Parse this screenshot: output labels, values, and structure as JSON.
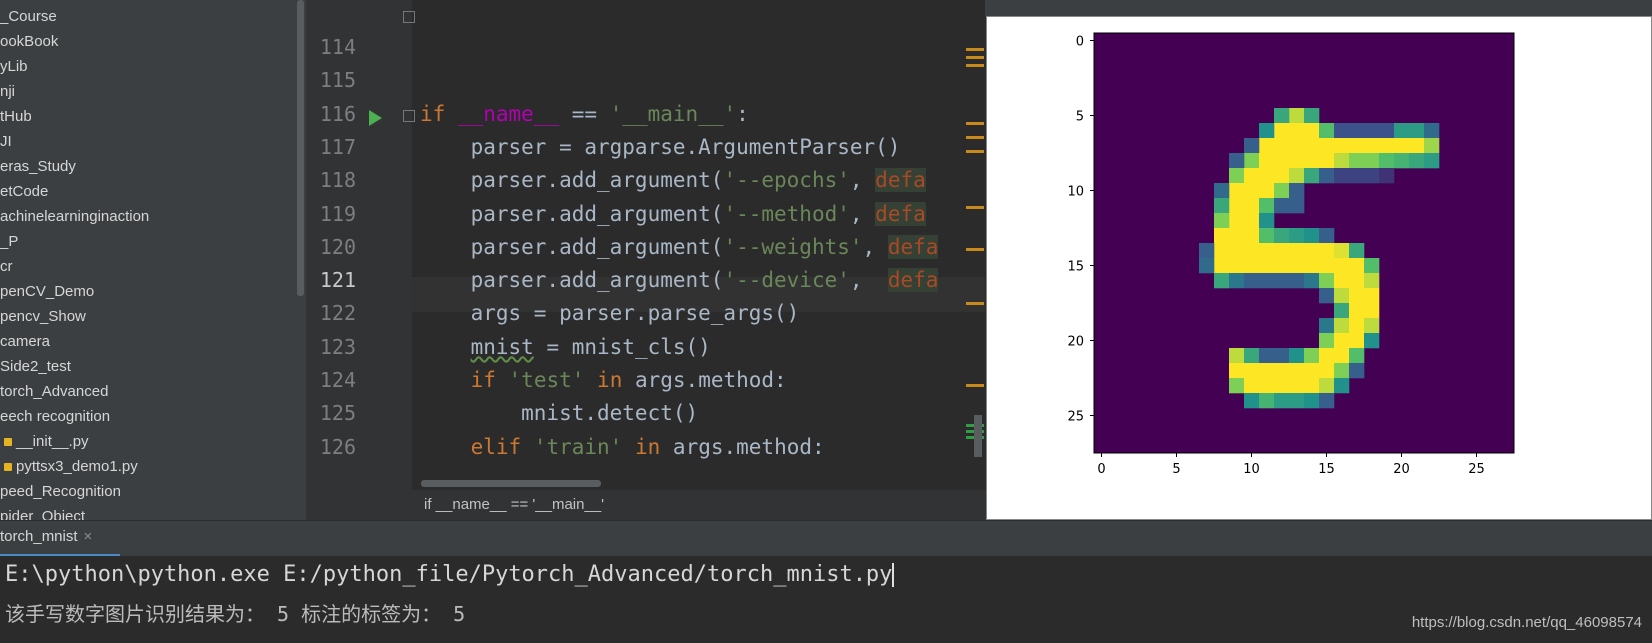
{
  "sidebar": {
    "items": [
      {
        "label": "_Course",
        "icon": ""
      },
      {
        "label": "ookBook",
        "icon": ""
      },
      {
        "label": "yLib",
        "icon": ""
      },
      {
        "label": "nji",
        "icon": ""
      },
      {
        "label": "tHub",
        "icon": ""
      },
      {
        "label": "JI",
        "icon": ""
      },
      {
        "label": "eras_Study",
        "icon": ""
      },
      {
        "label": "etCode",
        "icon": ""
      },
      {
        "label": "achinelearninginaction",
        "icon": ""
      },
      {
        "label": "_P",
        "icon": ""
      },
      {
        "label": "cr",
        "icon": ""
      },
      {
        "label": "penCV_Demo",
        "icon": ""
      },
      {
        "label": "pencv_Show",
        "icon": ""
      },
      {
        "label": "camera",
        "icon": ""
      },
      {
        "label": "Side2_test",
        "icon": ""
      },
      {
        "label": "torch_Advanced",
        "icon": ""
      },
      {
        "label": "eech recognition",
        "icon": ""
      },
      {
        "label": "__init__.py",
        "icon": "python-file-icon"
      },
      {
        "label": "pyttsx3_demo1.py",
        "icon": "python-file-icon"
      },
      {
        "label": "peed_Recognition",
        "icon": ""
      },
      {
        "label": "pider_Object",
        "icon": ""
      }
    ]
  },
  "editor": {
    "lines": [
      {
        "num": "114",
        "code": ""
      },
      {
        "num": "115",
        "code": ""
      },
      {
        "num": "116",
        "code": "if __name__ == '__main__':"
      },
      {
        "num": "117",
        "code": "    parser = argparse.ArgumentParser()"
      },
      {
        "num": "118",
        "code": "    parser.add_argument('--epochs', defa"
      },
      {
        "num": "119",
        "code": "    parser.add_argument('--method', defa"
      },
      {
        "num": "120",
        "code": "    parser.add_argument('--weights', defa"
      },
      {
        "num": "121",
        "code": "    parser.add_argument('--device',  defa"
      },
      {
        "num": "122",
        "code": "    args = parser.parse_args()"
      },
      {
        "num": "123",
        "code": "    mnist = mnist_cls()"
      },
      {
        "num": "124",
        "code": "    if 'test' in args.method:"
      },
      {
        "num": "125",
        "code": "        mnist.detect()"
      },
      {
        "num": "126",
        "code": "    elif 'train' in args.method:"
      }
    ],
    "current_line": "121",
    "breadcrumb": "if __name__ == '__main__'"
  },
  "tab": {
    "label": "torch_mnist",
    "close": "×"
  },
  "console": {
    "command": "E:\\python\\python.exe E:/python_file/Pytorch_Advanced/torch_mnist.py",
    "output": "该手写数字图片识别结果为： 5 标注的标签为： 5"
  },
  "watermark": "https://blog.csdn.net/qq_46098574",
  "chart_data": {
    "type": "heatmap",
    "title": "",
    "xlabel": "",
    "ylabel": "",
    "x_ticks": [
      0,
      5,
      10,
      15,
      20,
      25
    ],
    "y_ticks": [
      0,
      5,
      10,
      15,
      20,
      25
    ],
    "xlim": [
      -0.5,
      27.5
    ],
    "ylim": [
      27.5,
      -0.5
    ],
    "colormap": "viridis",
    "grid": false,
    "size": [
      28,
      28
    ],
    "pixels": [
      {
        "x": 13,
        "y": 5,
        "v": 0.9
      },
      {
        "x": 14,
        "y": 5,
        "v": 0.6
      },
      {
        "x": 12,
        "y": 5,
        "v": 0.6
      },
      {
        "x": 12,
        "y": 6,
        "v": 1
      },
      {
        "x": 13,
        "y": 6,
        "v": 1
      },
      {
        "x": 14,
        "y": 6,
        "v": 1
      },
      {
        "x": 11,
        "y": 6,
        "v": 0.5
      },
      {
        "x": 15,
        "y": 6,
        "v": 0.7
      },
      {
        "x": 16,
        "y": 6,
        "v": 0.25
      },
      {
        "x": 17,
        "y": 6,
        "v": 0.25
      },
      {
        "x": 18,
        "y": 6,
        "v": 0.25
      },
      {
        "x": 19,
        "y": 6,
        "v": 0.25
      },
      {
        "x": 20,
        "y": 6,
        "v": 0.55
      },
      {
        "x": 21,
        "y": 6,
        "v": 0.55
      },
      {
        "x": 22,
        "y": 6,
        "v": 0.35
      },
      {
        "x": 11,
        "y": 7,
        "v": 1
      },
      {
        "x": 12,
        "y": 7,
        "v": 1
      },
      {
        "x": 13,
        "y": 7,
        "v": 1
      },
      {
        "x": 14,
        "y": 7,
        "v": 1
      },
      {
        "x": 15,
        "y": 7,
        "v": 1
      },
      {
        "x": 16,
        "y": 7,
        "v": 1
      },
      {
        "x": 17,
        "y": 7,
        "v": 1
      },
      {
        "x": 18,
        "y": 7,
        "v": 1
      },
      {
        "x": 19,
        "y": 7,
        "v": 1
      },
      {
        "x": 20,
        "y": 7,
        "v": 1
      },
      {
        "x": 21,
        "y": 7,
        "v": 1
      },
      {
        "x": 22,
        "y": 7,
        "v": 0.85
      },
      {
        "x": 10,
        "y": 7,
        "v": 0.3
      },
      {
        "x": 10,
        "y": 8,
        "v": 0.8
      },
      {
        "x": 11,
        "y": 8,
        "v": 1
      },
      {
        "x": 12,
        "y": 8,
        "v": 1
      },
      {
        "x": 13,
        "y": 8,
        "v": 1
      },
      {
        "x": 14,
        "y": 8,
        "v": 1
      },
      {
        "x": 15,
        "y": 8,
        "v": 1
      },
      {
        "x": 16,
        "y": 8,
        "v": 0.9
      },
      {
        "x": 17,
        "y": 8,
        "v": 0.8
      },
      {
        "x": 18,
        "y": 8,
        "v": 0.8
      },
      {
        "x": 19,
        "y": 8,
        "v": 0.7
      },
      {
        "x": 20,
        "y": 8,
        "v": 0.65
      },
      {
        "x": 21,
        "y": 8,
        "v": 0.6
      },
      {
        "x": 22,
        "y": 8,
        "v": 0.55
      },
      {
        "x": 9,
        "y": 8,
        "v": 0.3
      },
      {
        "x": 9,
        "y": 9,
        "v": 0.8
      },
      {
        "x": 10,
        "y": 9,
        "v": 1
      },
      {
        "x": 11,
        "y": 9,
        "v": 1
      },
      {
        "x": 12,
        "y": 9,
        "v": 1
      },
      {
        "x": 13,
        "y": 9,
        "v": 0.9
      },
      {
        "x": 14,
        "y": 9,
        "v": 0.6
      },
      {
        "x": 15,
        "y": 9,
        "v": 0.3
      },
      {
        "x": 16,
        "y": 9,
        "v": 0.2
      },
      {
        "x": 17,
        "y": 9,
        "v": 0.2
      },
      {
        "x": 18,
        "y": 9,
        "v": 0.2
      },
      {
        "x": 19,
        "y": 9,
        "v": 0.15
      },
      {
        "x": 9,
        "y": 10,
        "v": 1
      },
      {
        "x": 10,
        "y": 10,
        "v": 1
      },
      {
        "x": 11,
        "y": 10,
        "v": 1
      },
      {
        "x": 12,
        "y": 10,
        "v": 0.8
      },
      {
        "x": 13,
        "y": 10,
        "v": 0.3
      },
      {
        "x": 8,
        "y": 10,
        "v": 0.35
      },
      {
        "x": 9,
        "y": 11,
        "v": 1
      },
      {
        "x": 10,
        "y": 11,
        "v": 1
      },
      {
        "x": 11,
        "y": 11,
        "v": 0.7
      },
      {
        "x": 12,
        "y": 11,
        "v": 0.3
      },
      {
        "x": 13,
        "y": 11,
        "v": 0.3
      },
      {
        "x": 8,
        "y": 11,
        "v": 0.6
      },
      {
        "x": 9,
        "y": 12,
        "v": 1
      },
      {
        "x": 10,
        "y": 12,
        "v": 1
      },
      {
        "x": 11,
        "y": 12,
        "v": 0.5
      },
      {
        "x": 8,
        "y": 12,
        "v": 0.8
      },
      {
        "x": 8,
        "y": 13,
        "v": 1
      },
      {
        "x": 9,
        "y": 13,
        "v": 1
      },
      {
        "x": 10,
        "y": 13,
        "v": 1
      },
      {
        "x": 11,
        "y": 13,
        "v": 0.7
      },
      {
        "x": 12,
        "y": 13,
        "v": 0.6
      },
      {
        "x": 13,
        "y": 13,
        "v": 0.55
      },
      {
        "x": 14,
        "y": 13,
        "v": 0.5
      },
      {
        "x": 15,
        "y": 13,
        "v": 0.3
      },
      {
        "x": 8,
        "y": 14,
        "v": 1
      },
      {
        "x": 9,
        "y": 14,
        "v": 1
      },
      {
        "x": 10,
        "y": 14,
        "v": 1
      },
      {
        "x": 11,
        "y": 14,
        "v": 1
      },
      {
        "x": 12,
        "y": 14,
        "v": 1
      },
      {
        "x": 13,
        "y": 14,
        "v": 1
      },
      {
        "x": 14,
        "y": 14,
        "v": 1
      },
      {
        "x": 15,
        "y": 14,
        "v": 1
      },
      {
        "x": 16,
        "y": 14,
        "v": 0.95
      },
      {
        "x": 17,
        "y": 14,
        "v": 0.6
      },
      {
        "x": 7,
        "y": 14,
        "v": 0.3
      },
      {
        "x": 8,
        "y": 15,
        "v": 1
      },
      {
        "x": 9,
        "y": 15,
        "v": 1
      },
      {
        "x": 10,
        "y": 15,
        "v": 1
      },
      {
        "x": 11,
        "y": 15,
        "v": 1
      },
      {
        "x": 12,
        "y": 15,
        "v": 1
      },
      {
        "x": 13,
        "y": 15,
        "v": 1
      },
      {
        "x": 14,
        "y": 15,
        "v": 1
      },
      {
        "x": 15,
        "y": 15,
        "v": 1
      },
      {
        "x": 16,
        "y": 15,
        "v": 1
      },
      {
        "x": 17,
        "y": 15,
        "v": 1
      },
      {
        "x": 18,
        "y": 15,
        "v": 0.7
      },
      {
        "x": 7,
        "y": 15,
        "v": 0.35
      },
      {
        "x": 8,
        "y": 16,
        "v": 0.6
      },
      {
        "x": 9,
        "y": 16,
        "v": 0.4
      },
      {
        "x": 10,
        "y": 16,
        "v": 0.3
      },
      {
        "x": 11,
        "y": 16,
        "v": 0.3
      },
      {
        "x": 12,
        "y": 16,
        "v": 0.3
      },
      {
        "x": 13,
        "y": 16,
        "v": 0.3
      },
      {
        "x": 14,
        "y": 16,
        "v": 0.4
      },
      {
        "x": 15,
        "y": 16,
        "v": 0.8
      },
      {
        "x": 16,
        "y": 16,
        "v": 1
      },
      {
        "x": 17,
        "y": 16,
        "v": 1
      },
      {
        "x": 18,
        "y": 16,
        "v": 0.9
      },
      {
        "x": 15,
        "y": 17,
        "v": 0.3
      },
      {
        "x": 16,
        "y": 17,
        "v": 0.9
      },
      {
        "x": 17,
        "y": 17,
        "v": 1
      },
      {
        "x": 18,
        "y": 17,
        "v": 1
      },
      {
        "x": 16,
        "y": 18,
        "v": 0.6
      },
      {
        "x": 17,
        "y": 18,
        "v": 1
      },
      {
        "x": 18,
        "y": 18,
        "v": 1
      },
      {
        "x": 15,
        "y": 19,
        "v": 0.4
      },
      {
        "x": 16,
        "y": 19,
        "v": 0.9
      },
      {
        "x": 17,
        "y": 19,
        "v": 1
      },
      {
        "x": 18,
        "y": 19,
        "v": 0.9
      },
      {
        "x": 15,
        "y": 20,
        "v": 0.8
      },
      {
        "x": 16,
        "y": 20,
        "v": 1
      },
      {
        "x": 17,
        "y": 20,
        "v": 1
      },
      {
        "x": 18,
        "y": 20,
        "v": 0.5
      },
      {
        "x": 9,
        "y": 21,
        "v": 0.9
      },
      {
        "x": 10,
        "y": 21,
        "v": 0.6
      },
      {
        "x": 11,
        "y": 21,
        "v": 0.3
      },
      {
        "x": 12,
        "y": 21,
        "v": 0.3
      },
      {
        "x": 13,
        "y": 21,
        "v": 0.5
      },
      {
        "x": 14,
        "y": 21,
        "v": 0.8
      },
      {
        "x": 15,
        "y": 21,
        "v": 1
      },
      {
        "x": 16,
        "y": 21,
        "v": 1
      },
      {
        "x": 17,
        "y": 21,
        "v": 0.7
      },
      {
        "x": 9,
        "y": 22,
        "v": 1
      },
      {
        "x": 10,
        "y": 22,
        "v": 1
      },
      {
        "x": 11,
        "y": 22,
        "v": 1
      },
      {
        "x": 12,
        "y": 22,
        "v": 1
      },
      {
        "x": 13,
        "y": 22,
        "v": 1
      },
      {
        "x": 14,
        "y": 22,
        "v": 1
      },
      {
        "x": 15,
        "y": 22,
        "v": 1
      },
      {
        "x": 16,
        "y": 22,
        "v": 0.8
      },
      {
        "x": 17,
        "y": 22,
        "v": 0.3
      },
      {
        "x": 9,
        "y": 23,
        "v": 0.8
      },
      {
        "x": 10,
        "y": 23,
        "v": 1
      },
      {
        "x": 11,
        "y": 23,
        "v": 1
      },
      {
        "x": 12,
        "y": 23,
        "v": 1
      },
      {
        "x": 13,
        "y": 23,
        "v": 1
      },
      {
        "x": 14,
        "y": 23,
        "v": 1
      },
      {
        "x": 15,
        "y": 23,
        "v": 0.9
      },
      {
        "x": 16,
        "y": 23,
        "v": 0.5
      },
      {
        "x": 10,
        "y": 24,
        "v": 0.5
      },
      {
        "x": 11,
        "y": 24,
        "v": 0.65
      },
      {
        "x": 12,
        "y": 24,
        "v": 0.55
      },
      {
        "x": 13,
        "y": 24,
        "v": 0.55
      },
      {
        "x": 14,
        "y": 24,
        "v": 0.5
      },
      {
        "x": 15,
        "y": 24,
        "v": 0.3
      }
    ]
  }
}
